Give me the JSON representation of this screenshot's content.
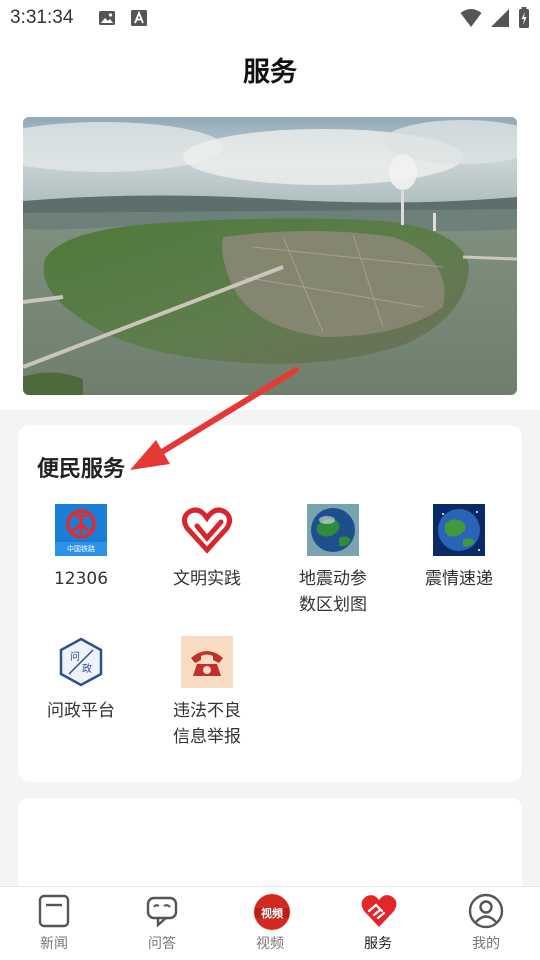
{
  "status_bar": {
    "time": "3:31:34"
  },
  "header": {
    "title": "服务"
  },
  "banner": {
    "alt": ""
  },
  "convenience": {
    "title": "便民服务",
    "items": [
      {
        "label": "12306",
        "icon": "railway-icon"
      },
      {
        "label": "文明实践",
        "icon": "heart-icon"
      },
      {
        "label": "地震动参数区划图",
        "icon": "earth-icon"
      },
      {
        "label": "震情速递",
        "icon": "earth-icon"
      },
      {
        "label": "问政平台",
        "icon": "wenzheng-icon"
      },
      {
        "label": "违法不良信息举报",
        "icon": "phone-icon"
      }
    ]
  },
  "tabbar": {
    "items": [
      {
        "label": "新闻"
      },
      {
        "label": "问答"
      },
      {
        "label": "视频",
        "badge": "视频"
      },
      {
        "label": "服务"
      },
      {
        "label": "我的"
      }
    ],
    "active": "服务"
  },
  "colors": {
    "accent": "#e4262b",
    "active_tab": "#222222"
  }
}
